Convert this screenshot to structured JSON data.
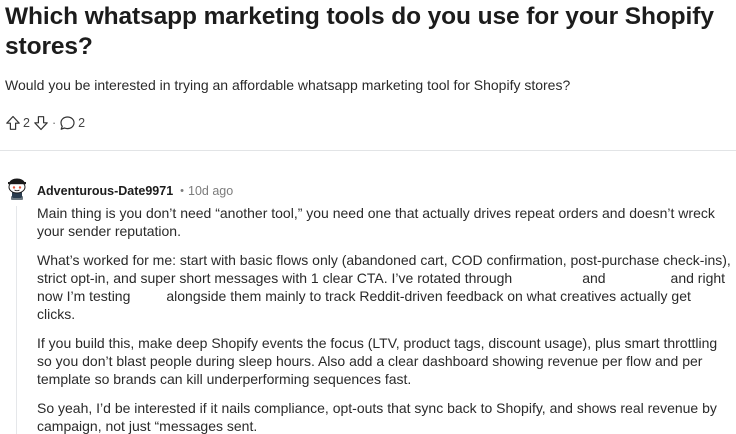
{
  "post": {
    "title": "Which whatsapp marketing tools do you use for your Shopify stores?",
    "body": "Would you be interested in trying an affordable whatsapp marketing tool for Shopify stores?",
    "upvotes": "2",
    "comments": "2"
  },
  "comment": {
    "username": "Adventurous-Date9971",
    "separator": "•",
    "time": "10d ago",
    "p1": "Main thing is you don’t need “another tool,” you need one that actually drives repeat orders and doesn’t wreck your sender reputation.",
    "p2_a": "What’s worked for me: start with basic flows only (abandoned cart, COD confirmation, post-purchase check-ins), strict opt-in, and super short messages with 1 clear CTA. I’ve rotated through",
    "p2_b": "and",
    "p2_c": "and right now I’m testing",
    "p2_d": "alongside them mainly to track Reddit-driven feedback on what creatives actually get clicks.",
    "p3": "If you build this, make deep Shopify events the focus (LTV, product tags, discount usage), plus smart throttling so you don’t blast people during sleep hours. Also add a clear dashboard showing revenue per flow and per template so brands can kill underperforming sequences fast.",
    "p4": "So yeah, I’d be interested if it nails compliance, opt-outs that sync back to Shopify, and shows real revenue by campaign, not just “messages sent."
  },
  "icons": {
    "upvote": "upvote-arrow-icon",
    "downvote": "downvote-arrow-icon",
    "comments": "comment-bubble-icon",
    "avatar": "snoo-avatar"
  },
  "colors": {
    "text": "#1c1c1c",
    "muted": "#7c7c7c",
    "divider": "#e2e4e6"
  }
}
